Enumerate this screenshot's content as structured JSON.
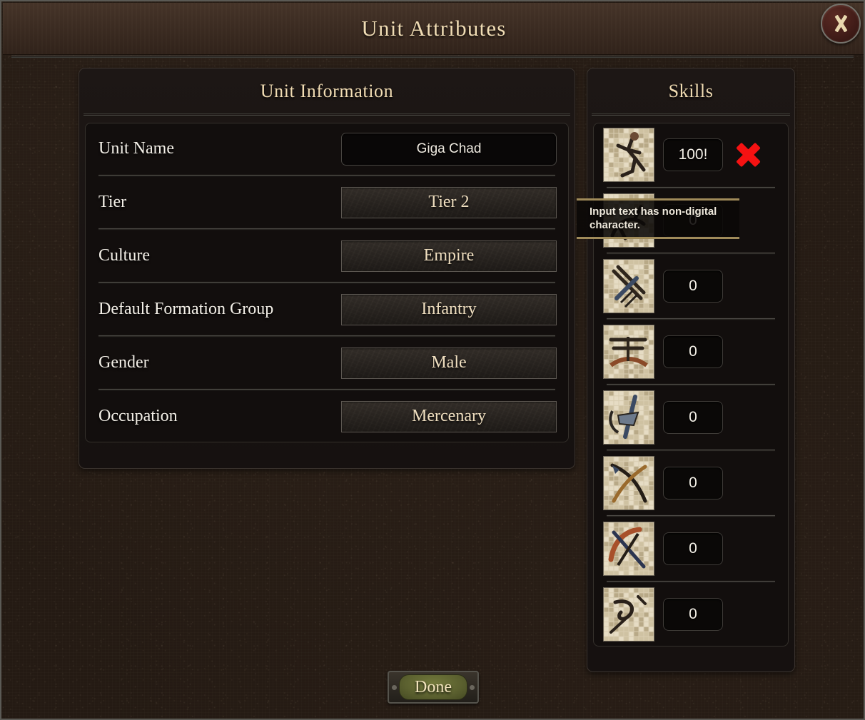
{
  "window": {
    "title": "Unit Attributes",
    "close_label": "Close"
  },
  "unit_information": {
    "header": "Unit Information",
    "rows": [
      {
        "label": "Unit Name",
        "value": "Giga Chad",
        "control": "text"
      },
      {
        "label": "Tier",
        "value": "Tier 2",
        "control": "dropdown"
      },
      {
        "label": "Culture",
        "value": "Empire",
        "control": "dropdown"
      },
      {
        "label": "Default Formation Group",
        "value": "Infantry",
        "control": "dropdown"
      },
      {
        "label": "Gender",
        "value": "Male",
        "control": "dropdown"
      },
      {
        "label": "Occupation",
        "value": "Mercenary",
        "control": "dropdown"
      }
    ]
  },
  "skills": {
    "header": "Skills",
    "rows": [
      {
        "icon": "athletics-mosaic-icon",
        "value": "100!",
        "has_error": true
      },
      {
        "icon": "riding-mosaic-icon",
        "value": "0",
        "has_error": false
      },
      {
        "icon": "one-handed-mosaic-icon",
        "value": "0",
        "has_error": false
      },
      {
        "icon": "two-handed-mosaic-icon",
        "value": "0",
        "has_error": false
      },
      {
        "icon": "polearm-mosaic-icon",
        "value": "0",
        "has_error": false
      },
      {
        "icon": "bow-mosaic-icon",
        "value": "0",
        "has_error": false
      },
      {
        "icon": "crossbow-mosaic-icon",
        "value": "0",
        "has_error": false
      },
      {
        "icon": "throwing-mosaic-icon",
        "value": "0",
        "has_error": false
      }
    ]
  },
  "tooltip": {
    "text": "Input text has non-digital character."
  },
  "footer": {
    "done_label": "Done"
  },
  "colors": {
    "accent_gold": "#f0dcb4",
    "error_red": "#f51212",
    "tooltip_border": "#a08b5a",
    "done_green": "#5b602f",
    "background": "#241a13"
  }
}
